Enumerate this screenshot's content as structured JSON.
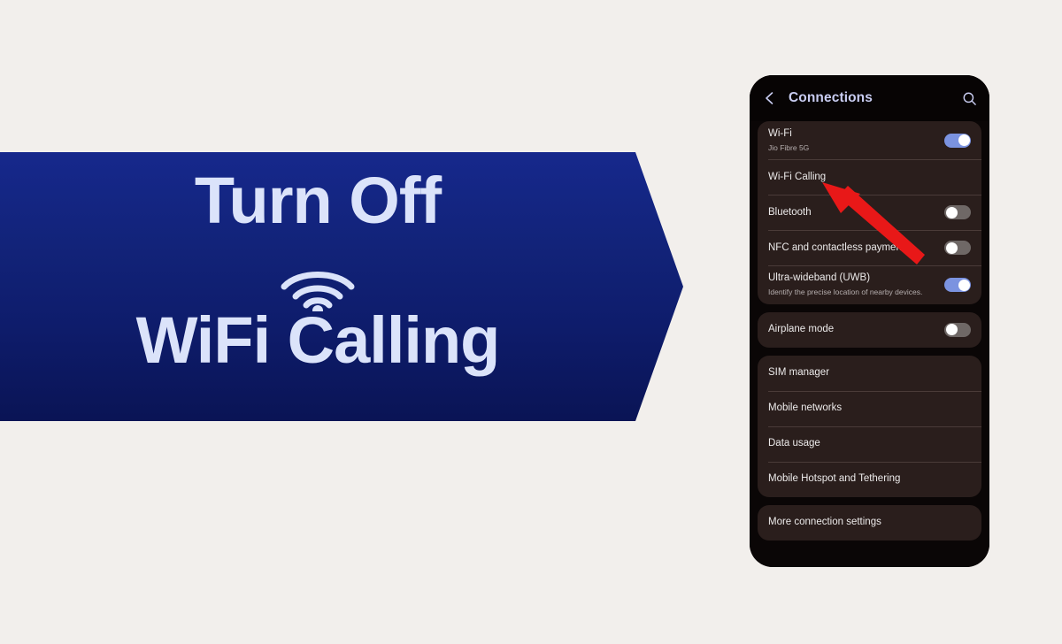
{
  "page": {
    "background_color": "#f2efec"
  },
  "banner": {
    "line1": "Turn Off",
    "line2": "WiFi Calling",
    "wifi_icon": "wifi-icon",
    "gradient_from": "#16288c",
    "gradient_to": "#0a1455",
    "text_color": "#dbe3fa"
  },
  "phone": {
    "header": {
      "back_icon": "chevron-left-icon",
      "title": "Connections",
      "search_icon": "search-icon",
      "title_color": "#c9cdf2"
    },
    "groups": [
      {
        "rows": [
          {
            "title": "Wi-Fi",
            "subtitle": "Jio Fibre 5G",
            "toggle": "on"
          },
          {
            "title": "Wi-Fi Calling",
            "subtitle": "",
            "toggle": "none"
          },
          {
            "title": "Bluetooth",
            "subtitle": "",
            "toggle": "off"
          },
          {
            "title": "NFC and contactless payments",
            "subtitle": "",
            "toggle": "off"
          },
          {
            "title": "Ultra-wideband (UWB)",
            "subtitle": "Identify the precise location of nearby devices.",
            "toggle": "on"
          }
        ]
      },
      {
        "rows": [
          {
            "title": "Airplane mode",
            "subtitle": "",
            "toggle": "off"
          }
        ]
      },
      {
        "rows": [
          {
            "title": "SIM manager",
            "subtitle": "",
            "toggle": "none"
          },
          {
            "title": "Mobile networks",
            "subtitle": "",
            "toggle": "none"
          },
          {
            "title": "Data usage",
            "subtitle": "",
            "toggle": "none"
          },
          {
            "title": "Mobile Hotspot and Tethering",
            "subtitle": "",
            "toggle": "none"
          }
        ]
      },
      {
        "rows": [
          {
            "title": "More connection settings",
            "subtitle": "",
            "toggle": "none"
          }
        ]
      }
    ],
    "toggle_on_color": "#7b93e0",
    "toggle_off_color": "#6f6866",
    "card_color": "#2a1e1c"
  },
  "annotation": {
    "arrow_color": "#e81818",
    "arrow_points_to": "Wi-Fi Calling"
  }
}
